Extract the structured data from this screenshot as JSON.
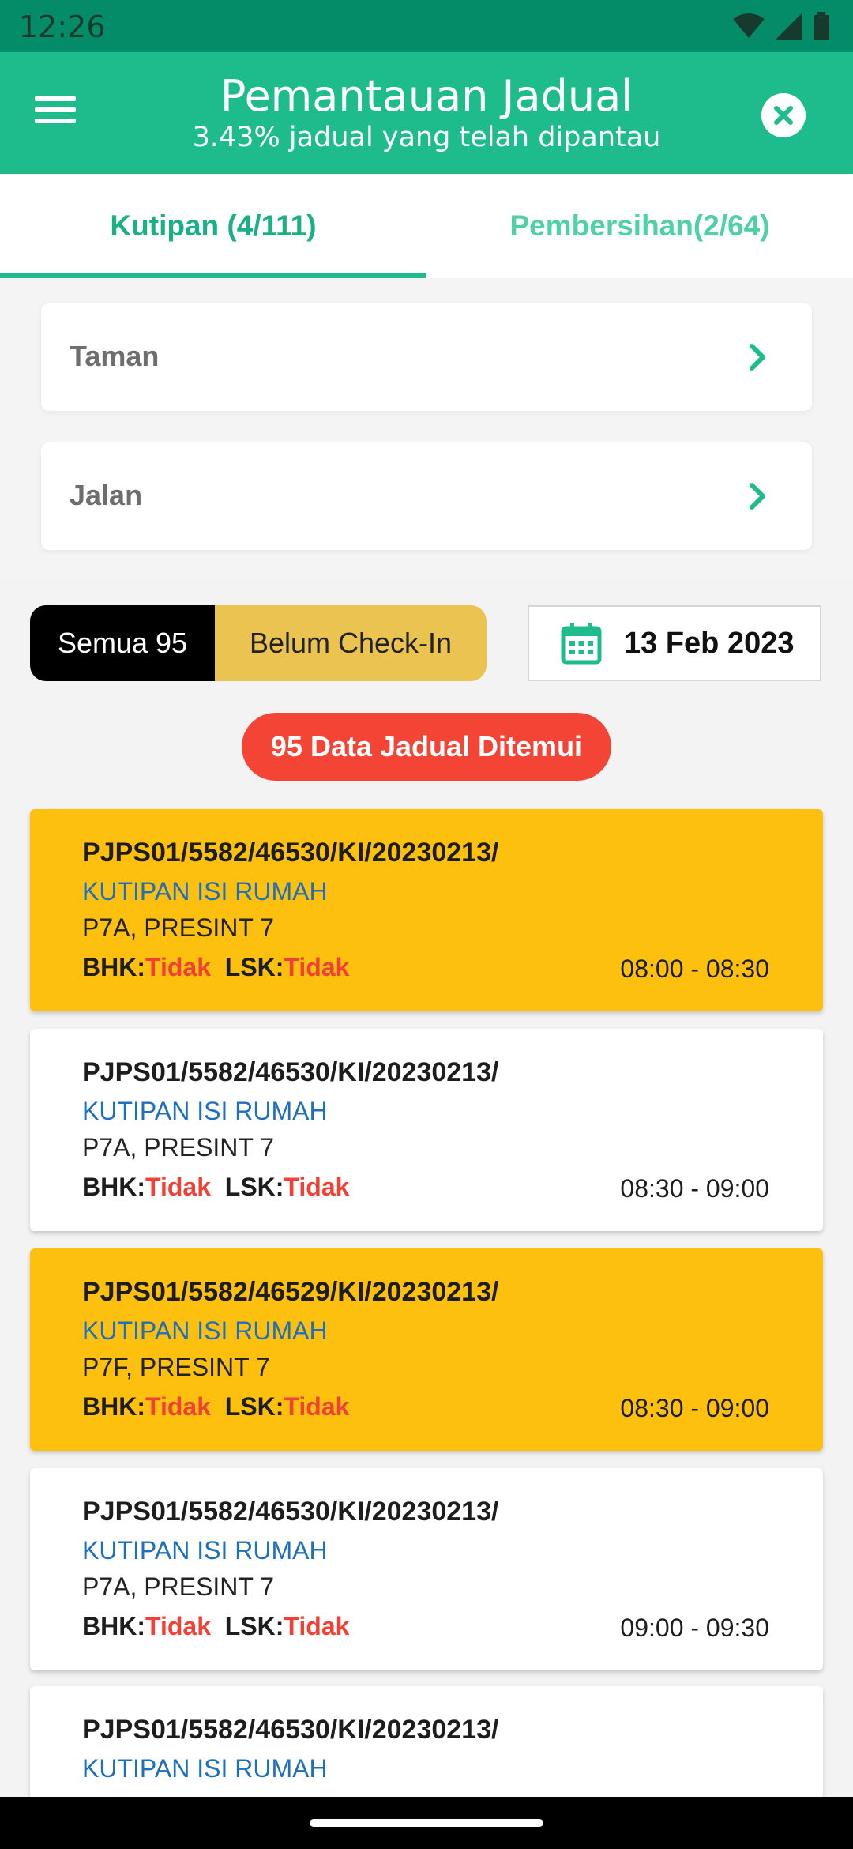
{
  "status_bar": {
    "time": "12:26",
    "icons": [
      "wifi-icon",
      "signal-icon",
      "battery-icon"
    ]
  },
  "app_bar": {
    "title": "Pemantauan Jadual",
    "subtitle": "3.43% jadual yang telah dipantau",
    "menu_icon": "hamburger-menu-icon",
    "close_icon": "close-circle-icon"
  },
  "tabs": [
    {
      "label": "Kutipan (4/111)",
      "active": true
    },
    {
      "label": "Pembersihan(2/64)",
      "active": false
    }
  ],
  "filters": [
    {
      "label": "Taman"
    },
    {
      "label": "Jalan"
    }
  ],
  "segment": {
    "all_label": "Semua 95",
    "pending_label": "Belum Check-In"
  },
  "date_picker": {
    "value": "13 Feb 2023",
    "icon": "calendar-icon"
  },
  "result_badge": "95 Data Jadual Ditemui",
  "schedules": [
    {
      "code": "PJPS01/5582/46530/KI/20230213/",
      "type": "KUTIPAN ISI RUMAH",
      "area": "P7A, PRESINT 7",
      "bhk_label": "BHK:",
      "bhk": "Tidak",
      "lsk_label": "LSK:",
      "lsk": "Tidak",
      "time": "08:00 - 08:30",
      "highlight": true
    },
    {
      "code": "PJPS01/5582/46530/KI/20230213/",
      "type": "KUTIPAN ISI RUMAH",
      "area": "P7A, PRESINT 7",
      "bhk_label": "BHK:",
      "bhk": "Tidak",
      "lsk_label": "LSK:",
      "lsk": "Tidak",
      "time": "08:30 - 09:00",
      "highlight": false
    },
    {
      "code": "PJPS01/5582/46529/KI/20230213/",
      "type": "KUTIPAN ISI RUMAH",
      "area": "P7F, PRESINT 7",
      "bhk_label": "BHK:",
      "bhk": "Tidak",
      "lsk_label": "LSK:",
      "lsk": "Tidak",
      "time": "08:30 - 09:00",
      "highlight": true
    },
    {
      "code": "PJPS01/5582/46530/KI/20230213/",
      "type": "KUTIPAN ISI RUMAH",
      "area": "P7A, PRESINT 7",
      "bhk_label": "BHK:",
      "bhk": "Tidak",
      "lsk_label": "LSK:",
      "lsk": "Tidak",
      "time": "09:00 - 09:30",
      "highlight": false
    },
    {
      "code": "PJPS01/5582/46530/KI/20230213/",
      "type": "KUTIPAN ISI RUMAH",
      "area": "",
      "bhk_label": "",
      "bhk": "",
      "lsk_label": "",
      "lsk": "",
      "time": "",
      "highlight": false
    }
  ],
  "colors": {
    "primary": "#1ebc8c",
    "status_bar": "#048c68",
    "card_highlight": "#fdc00e",
    "badge_red": "#f34436",
    "segment_pending": "#eac350",
    "link_blue": "#1f6fbf"
  }
}
